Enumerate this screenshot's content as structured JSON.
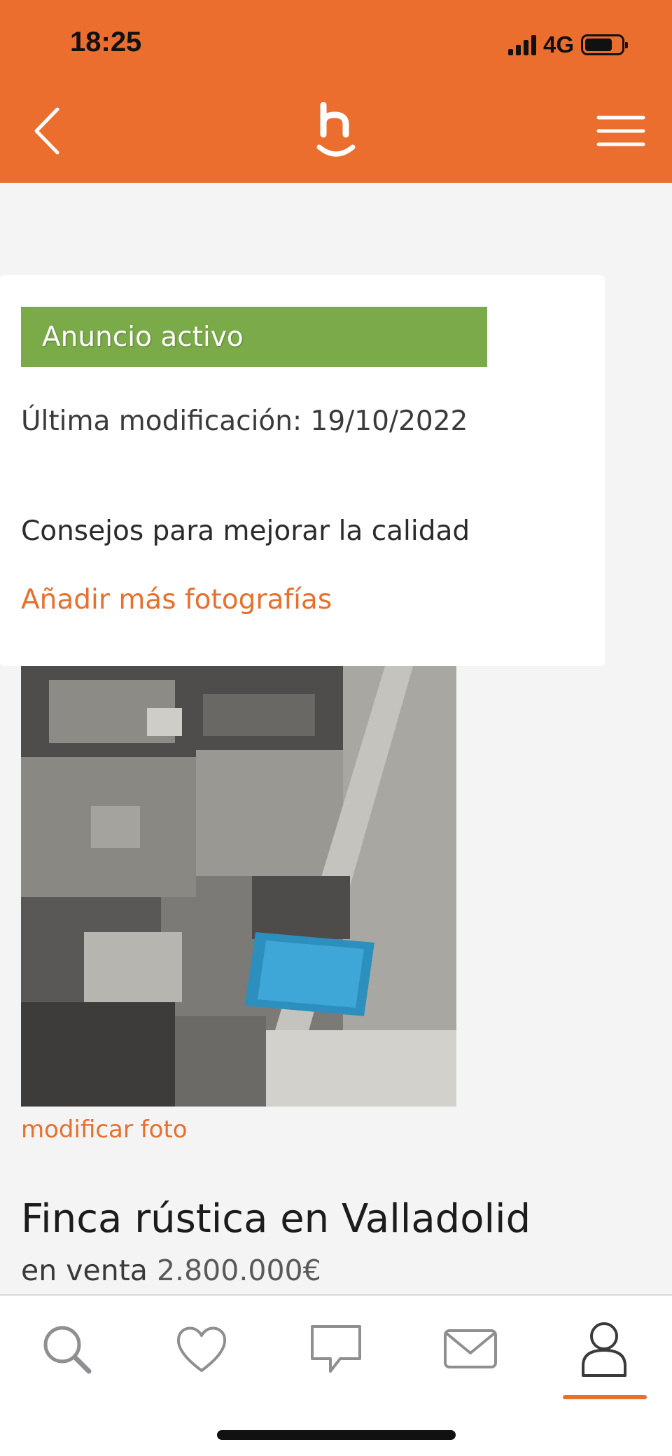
{
  "status_bar": {
    "time": "18:25",
    "network": "4G",
    "battery_level": 0.75
  },
  "header": {
    "background": "#ec6e2e",
    "back_icon": "chevron-left-icon",
    "logo_letter": "h",
    "menu_icon": "hamburger-menu-icon"
  },
  "status_card": {
    "badge_label": "Anuncio activo",
    "badge_color": "#7bab48",
    "last_modified": "Última modificación: 19/10/2022",
    "tips_title": "Consejos para mejorar la calidad",
    "tip_link": "Añadir más fotografías"
  },
  "listing": {
    "edit_photo_link": "modificar foto",
    "title": "Finca rústica en Valladolid",
    "operation": "en venta",
    "price": "2.800.000€"
  },
  "tab_bar": {
    "tabs": [
      {
        "icon": "search-icon"
      },
      {
        "icon": "heart-icon"
      },
      {
        "icon": "chat-bubble-icon"
      },
      {
        "icon": "mail-icon"
      },
      {
        "icon": "user-icon",
        "active": true
      }
    ],
    "accent": "#e86f2c"
  }
}
